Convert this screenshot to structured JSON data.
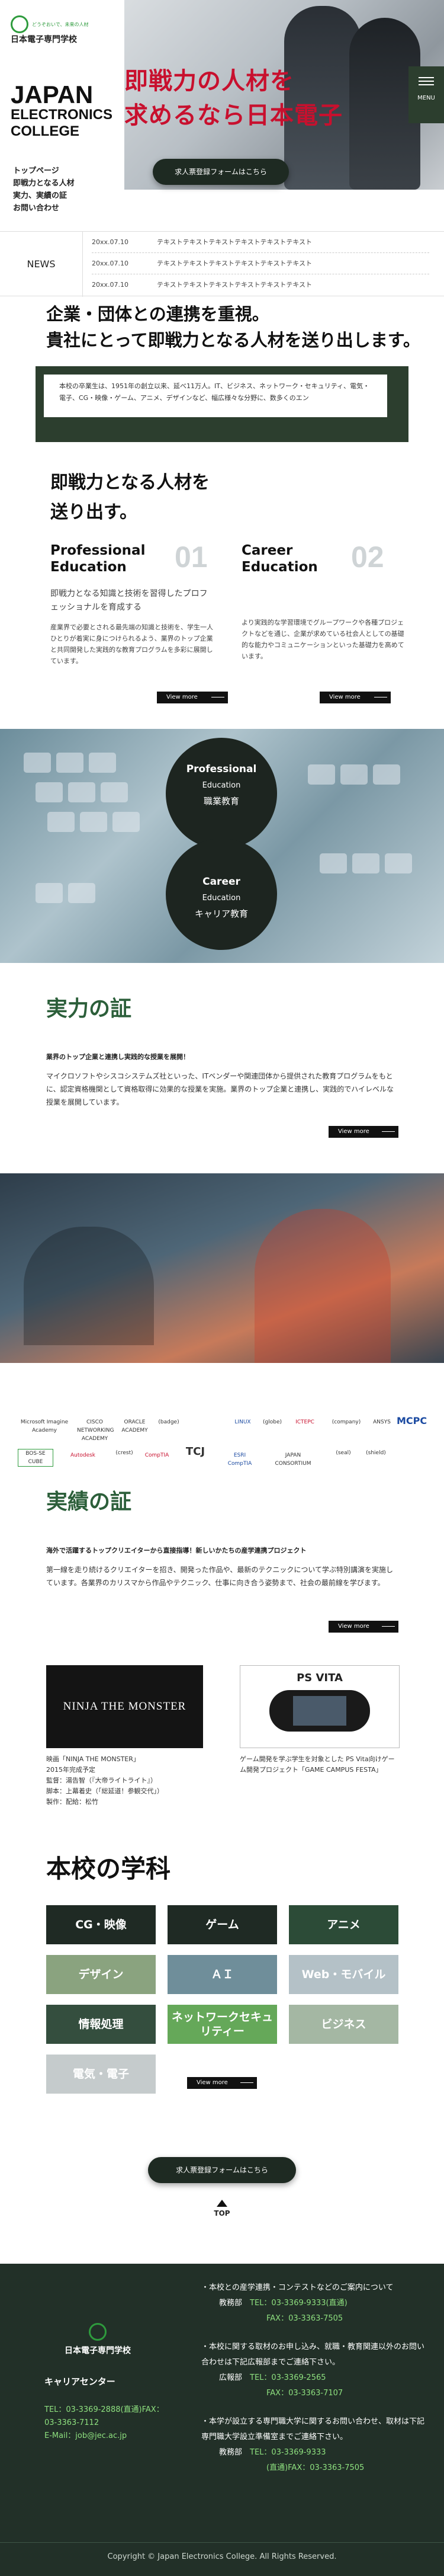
{
  "brand": {
    "logo_small": "どうぞおいで、未来の人材",
    "logo_name": "日本電子専門学校"
  },
  "hero": {
    "side_title_line1": "JAPAN",
    "side_title_line2": "ELECTRONICS",
    "side_title_line3": "COLLEGE",
    "side_desc": [
      "トップページ",
      "即戦力となる人材",
      "実力、実績の証",
      "お問い合わせ"
    ],
    "copy_line1": "即戦力の人材を",
    "copy_line2": "求めるなら日本電子",
    "button": "求人票登録フォームはこちら",
    "menu_label": "MENU"
  },
  "news": {
    "label": "NEWS",
    "items": [
      {
        "date": "20xx.07.10",
        "text": "テキストテキストテキストテキストテキストテキスト"
      },
      {
        "date": "20xx.07.10",
        "text": "テキストテキストテキストテキストテキストテキスト"
      },
      {
        "date": "20xx.07.10",
        "text": "テキストテキストテキストテキストテキストテキスト"
      }
    ]
  },
  "intro": {
    "title_line1": "企業・団体との連携を重視。",
    "title_line2": "貴社にとって即戦力となる人材を送り出します。",
    "body": "本校の卒業生は、1951年の創立以来、延べ11万人。IT、ビジネス、ネットワーク・セキュリティ、電気・電子、CG・映像・ゲーム、アニメ、デザインなど、幅広様々な分野に、数多くのエン"
  },
  "immediate": {
    "title_line1": "即戦力となる人材を",
    "title_line2": "送り出す。",
    "cols": [
      {
        "en1": "Professional",
        "en2": "Education",
        "num": "01",
        "lead": "即戦力となる知識と技術を習得したプロフェッショナルを育成する",
        "body": "産業界で必要とされる最先端の知識と技術を、学生一人ひとりが着実に身につけられるよう、業界のトップ企業と共同開発した実践的な教育プログラムを多彩に展開しています。",
        "btn": "View more"
      },
      {
        "en1": "Career",
        "en2": "Education",
        "num": "02",
        "lead": "",
        "body": "より実践的な学習環境でグループワークや各種プロジェクトなどを通じ、企業が求めている社会人としての基礎的な能力やコミュニケーションといった基礎力を高めています。",
        "btn": "View more"
      }
    ]
  },
  "circles": [
    {
      "en": "Professional",
      "sm": "Education",
      "jp": "職業教育"
    },
    {
      "en": "Career",
      "sm": "Education",
      "jp": "キャリア教育"
    }
  ],
  "proof": {
    "title": "実力の証",
    "head": "業界のトップ企業と連携し実践的な授業を展開！",
    "body": "マイクロソフトやシスコシステムズ社といった、ITベンダーや関連団体から提供された教育プログラムをもとに、認定資格機関として資格取得に効果的な授業を実施。業界のトップ企業と連携し、実践的でハイレベルな授業を展開しています。",
    "btn": "View more"
  },
  "logos": [
    "Microsoft Imagine Academy",
    "CISCO NETWORKING ACADEMY",
    "ORACLE ACADEMY",
    "(badge)",
    "LINUX",
    "(globe)",
    "ICTEPC",
    "(company)",
    "ANSYS",
    "MCPC",
    "BOS-SE CUBE",
    "Autodesk",
    "(crest)",
    "CompTIA",
    "TCJ",
    "ESRI CompTIA",
    "JAPAN CONSORTIUM",
    "(seal)",
    "(shield)"
  ],
  "works": {
    "title": "実績の証",
    "head": "海外で活躍するトップクリエイターから直接指導！新しいかたちの産学連携プロジェクト",
    "body": "第一線を走り続けるクリエイターを招き、開発った作品や、最新のテクニックについて学ぶ特別講演を実施しています。各業界のカリスマから作品やテクニック、仕事に向き合う姿勢まで、社会の最前線を学びます。",
    "btn": "View more",
    "items": [
      {
        "img": "NINJA THE MONSTER",
        "caption": [
          "映画「NINJA THE MONSTER」",
          "2015年完成予定",
          "監督：湯告智（『大帝ライトライト』）",
          "脚本：上幕着史（「総延道！参観交代」）",
          "製作：配給：松竹"
        ]
      },
      {
        "img": "PS VITA",
        "caption": [
          "ゲーム開発を学ぶ学生を対象とした PS Vita向けゲーム開発プロジェクト「GAME CAMPUS FESTA」"
        ]
      }
    ]
  },
  "depts": {
    "title": "本校の学科",
    "items": [
      "CG・映像",
      "ゲーム",
      "アニメ",
      "デザイン",
      "ＡＩ",
      "Web・モバイル",
      "情報処理",
      "ネットワークセキュリティー",
      "ビジネス",
      "電気・電子"
    ],
    "btn": "View more",
    "cta": "求人票登録フォームはこちら",
    "top": "TOP"
  },
  "colors": {
    "dept": [
      "#1f2a24",
      "#1f2a24",
      "#2c4b37",
      "#8aa37f",
      "#6f8e9a",
      "#b4c1c7",
      "#344e3e",
      "#65a859",
      "#a4b7a3",
      "#c5cbcc"
    ]
  },
  "footer": {
    "center": "キャリアセンター",
    "tel": "TEL：03-3369-2888(直通)FAX：",
    "fax": "03-3363-7112",
    "email": "E-Mail：job@jec.ac.jp",
    "r1": "・本校との産学連携・コンテストなどのご案内について",
    "r1_dept": "教務部",
    "r1_tel": "TEL：03-3369-9333(直通)",
    "r1_fax": "FAX：03-3363-7505",
    "r2": "・本校に関する取材のお申し込み、就職・教育関連以外のお問い合わせは下記広報部までご連絡下さい。",
    "r2_dept": "広報部",
    "r2_tel": "TEL：03-3369-2565",
    "r2_fax": "FAX：03-3363-7107",
    "r3": "・本学が設立する専門職大学に関するお問い合わせ、取材は下記専門職大学設立準備室までご連絡下さい。",
    "r3_dept": "教務部",
    "r3_tel": "TEL：03-3369-9333",
    "r3_fax": "(直通)FAX：03-3363-7505",
    "copyright": "Copyright © Japan Electronics College. All Rights Reserved."
  }
}
